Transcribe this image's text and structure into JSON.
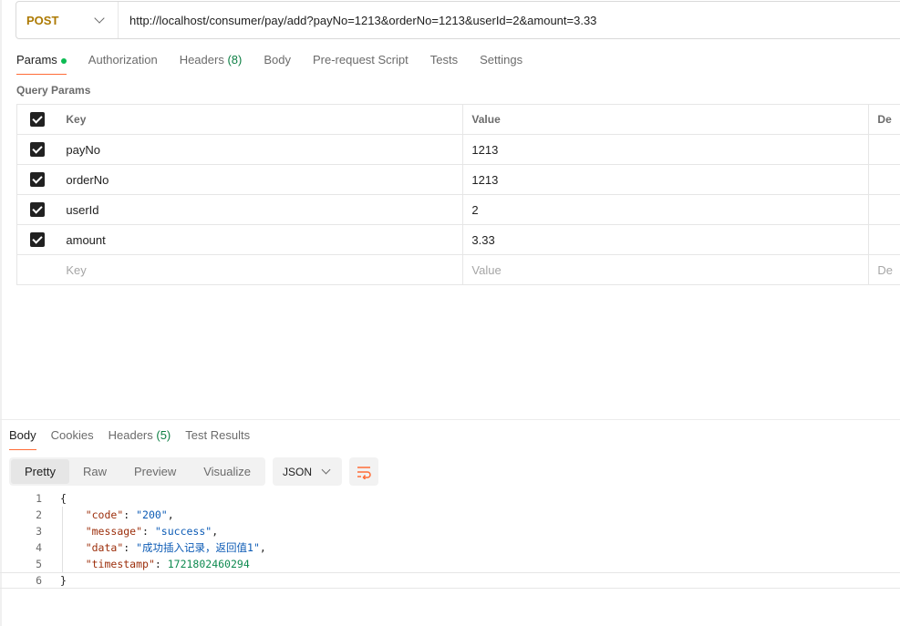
{
  "request": {
    "method": "POST",
    "url": "http://localhost/consumer/pay/add?payNo=1213&orderNo=1213&userId=2&amount=3.33"
  },
  "request_tabs": {
    "params": "Params",
    "authorization": "Authorization",
    "headers": "Headers",
    "headers_count": "(8)",
    "body": "Body",
    "prerequest": "Pre-request Script",
    "tests": "Tests",
    "settings": "Settings"
  },
  "query_params": {
    "title": "Query Params",
    "headers": {
      "key": "Key",
      "value": "Value",
      "description": "De"
    },
    "rows": [
      {
        "key": "payNo",
        "value": "1213",
        "checked": true
      },
      {
        "key": "orderNo",
        "value": "1213",
        "checked": true
      },
      {
        "key": "userId",
        "value": "2",
        "checked": true
      },
      {
        "key": "amount",
        "value": "3.33",
        "checked": true
      }
    ],
    "placeholder": {
      "key": "Key",
      "value": "Value",
      "description": "De"
    }
  },
  "response_tabs": {
    "body": "Body",
    "cookies": "Cookies",
    "headers": "Headers",
    "headers_count": "(5)",
    "test_results": "Test Results"
  },
  "view_modes": {
    "pretty": "Pretty",
    "raw": "Raw",
    "preview": "Preview",
    "visualize": "Visualize"
  },
  "format": "JSON",
  "response_body": {
    "line_numbers": [
      "1",
      "2",
      "3",
      "4",
      "5",
      "6"
    ],
    "open_brace": "{",
    "close_brace": "}",
    "code_key": "\"code\"",
    "code_val": "\"200\"",
    "message_key": "\"message\"",
    "message_val": "\"success\"",
    "data_key": "\"data\"",
    "data_val": "\"成功插入记录，返回值1\"",
    "timestamp_key": "\"timestamp\"",
    "timestamp_val": "1721802460294"
  },
  "colors": {
    "method": "#ad7a03",
    "active_tab_underline": "#ff6c37",
    "params_dot": "#0cbb52",
    "count": "#0c7f43",
    "json_key": "#9c2e0b",
    "json_string": "#0c5bb5",
    "json_number": "#0f8a50"
  }
}
